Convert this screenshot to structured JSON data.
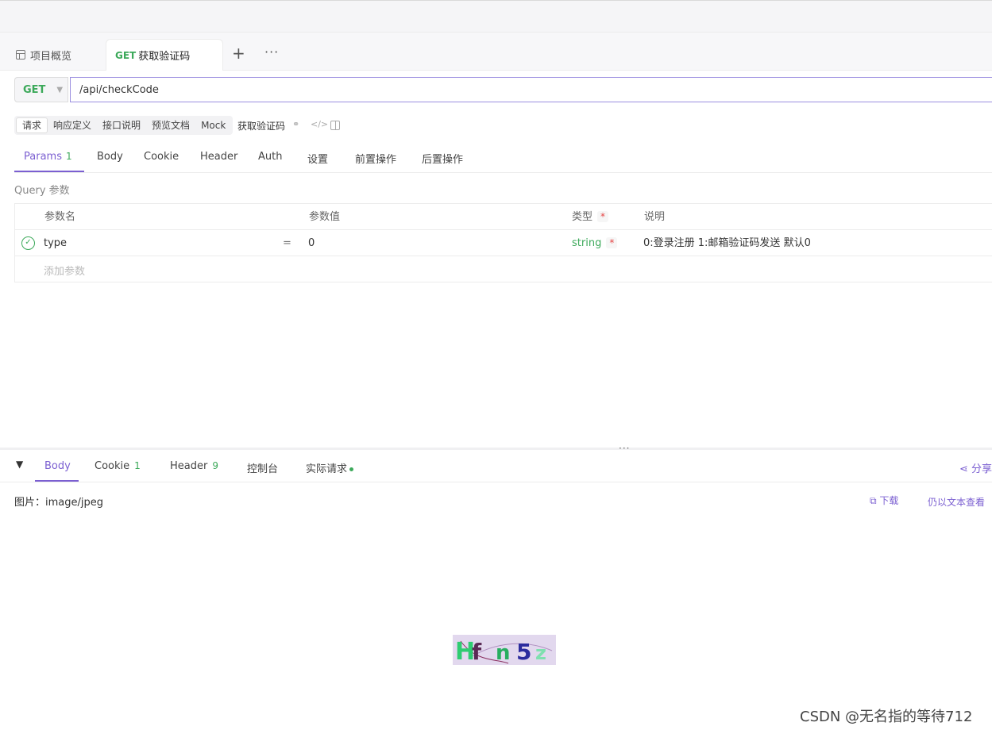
{
  "tabs": {
    "overview": "项目概览",
    "active_method": "GET",
    "active_title": "获取验证码",
    "add": "+",
    "more": "···"
  },
  "request": {
    "method": "GET",
    "url": "/api/checkCode"
  },
  "subtabs": [
    "请求",
    "响应定义",
    "接口说明",
    "预览文档",
    "Mock"
  ],
  "api_name": "获取验证码",
  "req_tabs": {
    "params": "Params",
    "params_count": "1",
    "body": "Body",
    "cookie": "Cookie",
    "header": "Header",
    "auth": "Auth",
    "settings": "设置",
    "pre_ops": "前置操作",
    "post_ops": "后置操作"
  },
  "query_label": "Query 参数",
  "param_table": {
    "headers": {
      "name": "参数名",
      "value": "参数值",
      "type": "类型",
      "desc": "说明",
      "required": "*"
    },
    "rows": [
      {
        "name": "type",
        "eq": "=",
        "value": "0",
        "type": "string",
        "required": "*",
        "desc": "0:登录注册  1:邮箱验证码发送  默认0"
      }
    ],
    "add_placeholder": "添加参数"
  },
  "divider_handle": "···",
  "resp_tabs": {
    "body": "Body",
    "cookie": "Cookie",
    "cookie_count": "1",
    "header": "Header",
    "header_count": "9",
    "console": "控制台",
    "actual": "实际请求",
    "share": "分享"
  },
  "response": {
    "image_type": "图片：image/jpeg",
    "download": "下载",
    "view_as_text": "仍以文本查看",
    "captcha_chars": [
      "H",
      "f",
      "n",
      "5",
      "z"
    ],
    "captcha_colors": [
      "#2ecc71",
      "#5b2b55",
      "#27ae60",
      "#2c2c9e",
      "#7fe0b0"
    ]
  },
  "watermark": "CSDN @无名指的等待712",
  "colors": {
    "accent": "#7b5fd1",
    "success": "#3ca95a",
    "required": "#e54545"
  },
  "icons": [
    "overview-icon",
    "chevron-down-icon",
    "link-icon",
    "code-icon",
    "panel-icon",
    "check-circle-icon",
    "collapse-chevron-icon",
    "share-icon",
    "external-icon"
  ]
}
